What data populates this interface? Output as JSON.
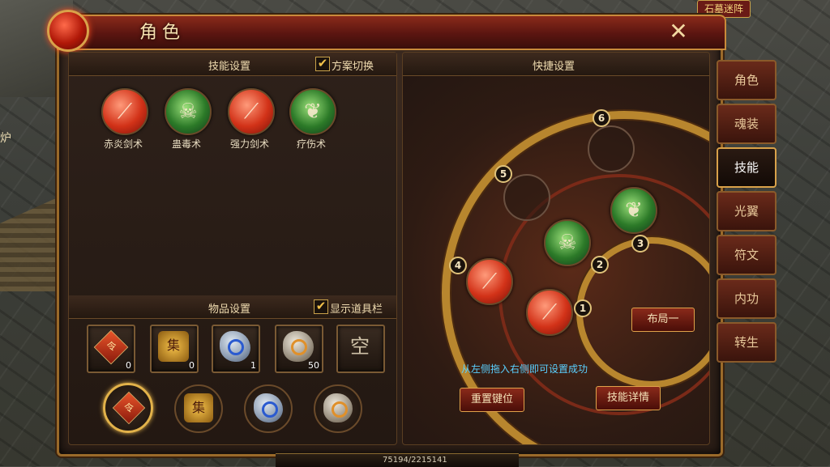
{
  "window": {
    "title": "角色",
    "close_icon": "close-icon",
    "close_glyph": "✕"
  },
  "scenery": {
    "furnace_text": "炉",
    "top_right_sign": "石墓迷阵"
  },
  "skills_section": {
    "title": "技能设置",
    "toggle_label": "方案切换",
    "toggle_checked": true,
    "skills": [
      {
        "name": "赤炎剑术",
        "color": "red"
      },
      {
        "name": "蛊毒术",
        "color": "green"
      },
      {
        "name": "强力剑术",
        "color": "red"
      },
      {
        "name": "疗伤术",
        "color": "green"
      }
    ]
  },
  "items_section": {
    "title": "物品设置",
    "toggle_label": "显示道具栏",
    "toggle_checked": true,
    "slots": [
      {
        "icon": "token-icon",
        "glyph": "令",
        "count": "0"
      },
      {
        "icon": "collect-icon",
        "glyph": "集",
        "count": "0"
      },
      {
        "icon": "blue-stone-icon",
        "glyph": "",
        "count": "1"
      },
      {
        "icon": "gold-stone-icon",
        "glyph": "",
        "count": "50"
      },
      {
        "icon": "empty-icon",
        "glyph": "空",
        "count": ""
      }
    ],
    "quick_items": [
      {
        "icon": "token-icon",
        "glyph": "令",
        "selected": true
      },
      {
        "icon": "collect-icon",
        "glyph": "集",
        "selected": false
      },
      {
        "icon": "blue-stone-icon",
        "glyph": "",
        "selected": false
      },
      {
        "icon": "gold-stone-icon",
        "glyph": "",
        "selected": false
      }
    ]
  },
  "shortcut_section": {
    "title": "快捷设置",
    "slot_numbers": [
      "1",
      "2",
      "3",
      "4",
      "5",
      "6"
    ],
    "hint": "从左侧拖入右侧即可设置成功",
    "layout_button": "布局一",
    "reset_button": "重置键位",
    "detail_button": "技能详情"
  },
  "side_tabs": [
    "角色",
    "魂装",
    "技能",
    "光翼",
    "符文",
    "内功",
    "转生"
  ],
  "active_tab": "技能",
  "status": {
    "exp": "75194/2215141"
  }
}
